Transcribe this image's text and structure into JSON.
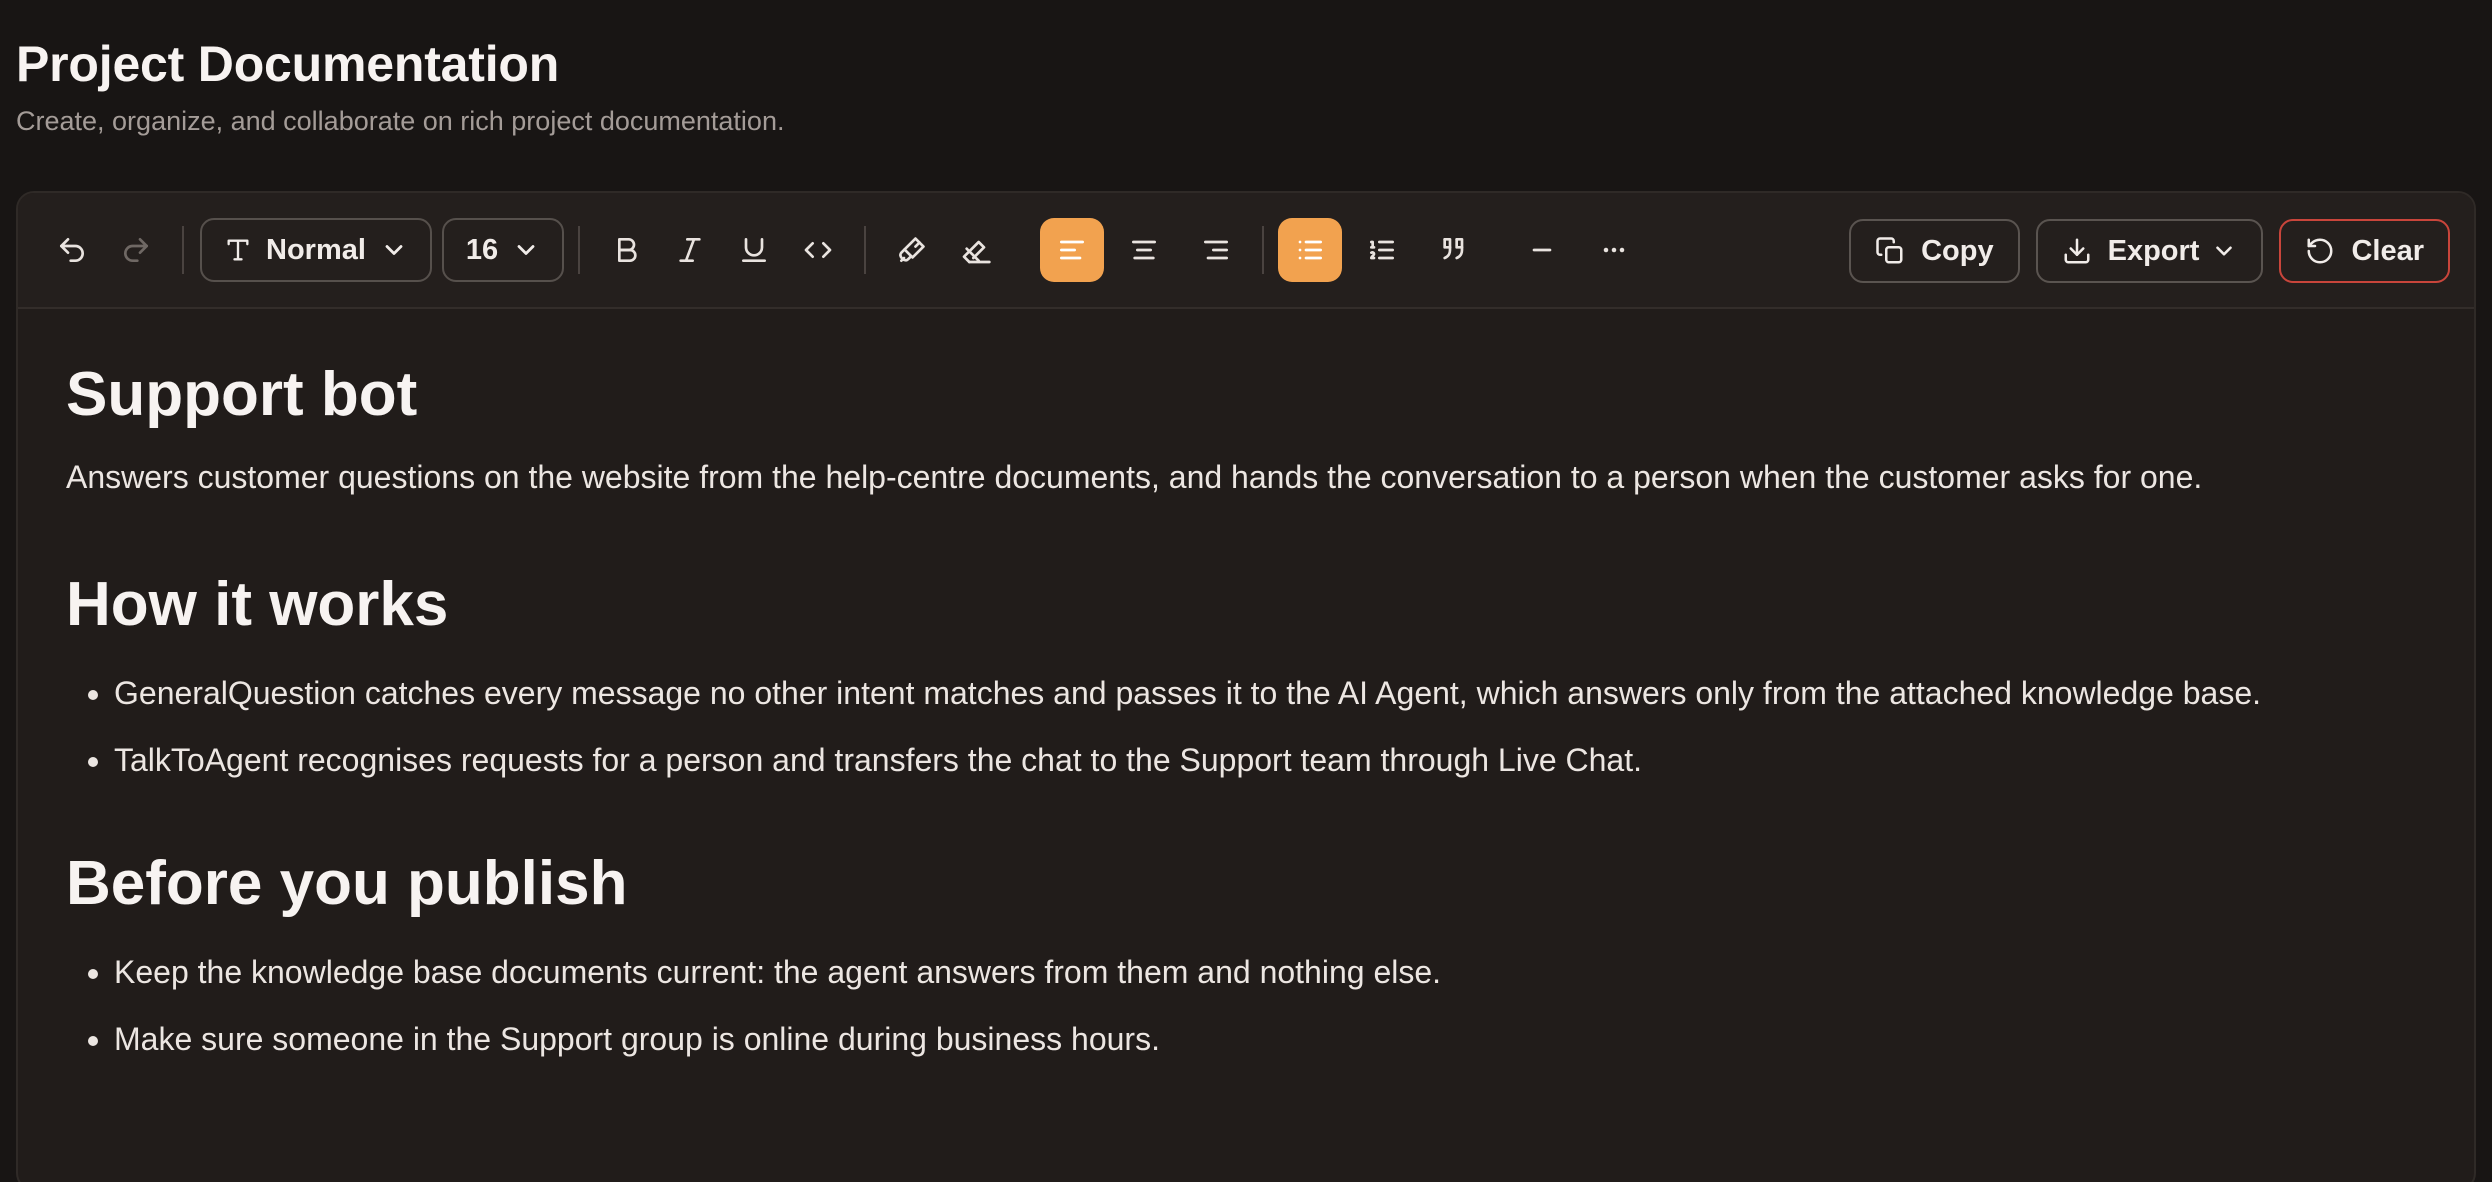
{
  "header": {
    "title": "Project Documentation",
    "subtitle": "Create, organize, and collaborate on rich project documentation."
  },
  "toolbar": {
    "block_type": "Normal",
    "font_size": "16",
    "copy_label": "Copy",
    "export_label": "Export",
    "clear_label": "Clear",
    "active_alignment": "left",
    "active_list": "bullet",
    "accent_color": "#f2a24f",
    "danger_color": "#c9453b"
  },
  "document": {
    "heading1": "Support bot",
    "intro": "Answers customer questions on the website from the help-centre documents, and hands the conversation to a person when the customer asks for one.",
    "heading2": "How it works",
    "how_items": [
      "GeneralQuestion catches every message no other intent matches and passes it to the AI Agent, which answers only from the attached knowledge base.",
      "TalkToAgent recognises requests for a person and transfers the chat to the Support team through Live Chat."
    ],
    "heading3": "Before you publish",
    "publish_items": [
      "Keep the knowledge base documents current: the agent answers from them and nothing else.",
      "Make sure someone in the Support group is online during business hours."
    ]
  }
}
